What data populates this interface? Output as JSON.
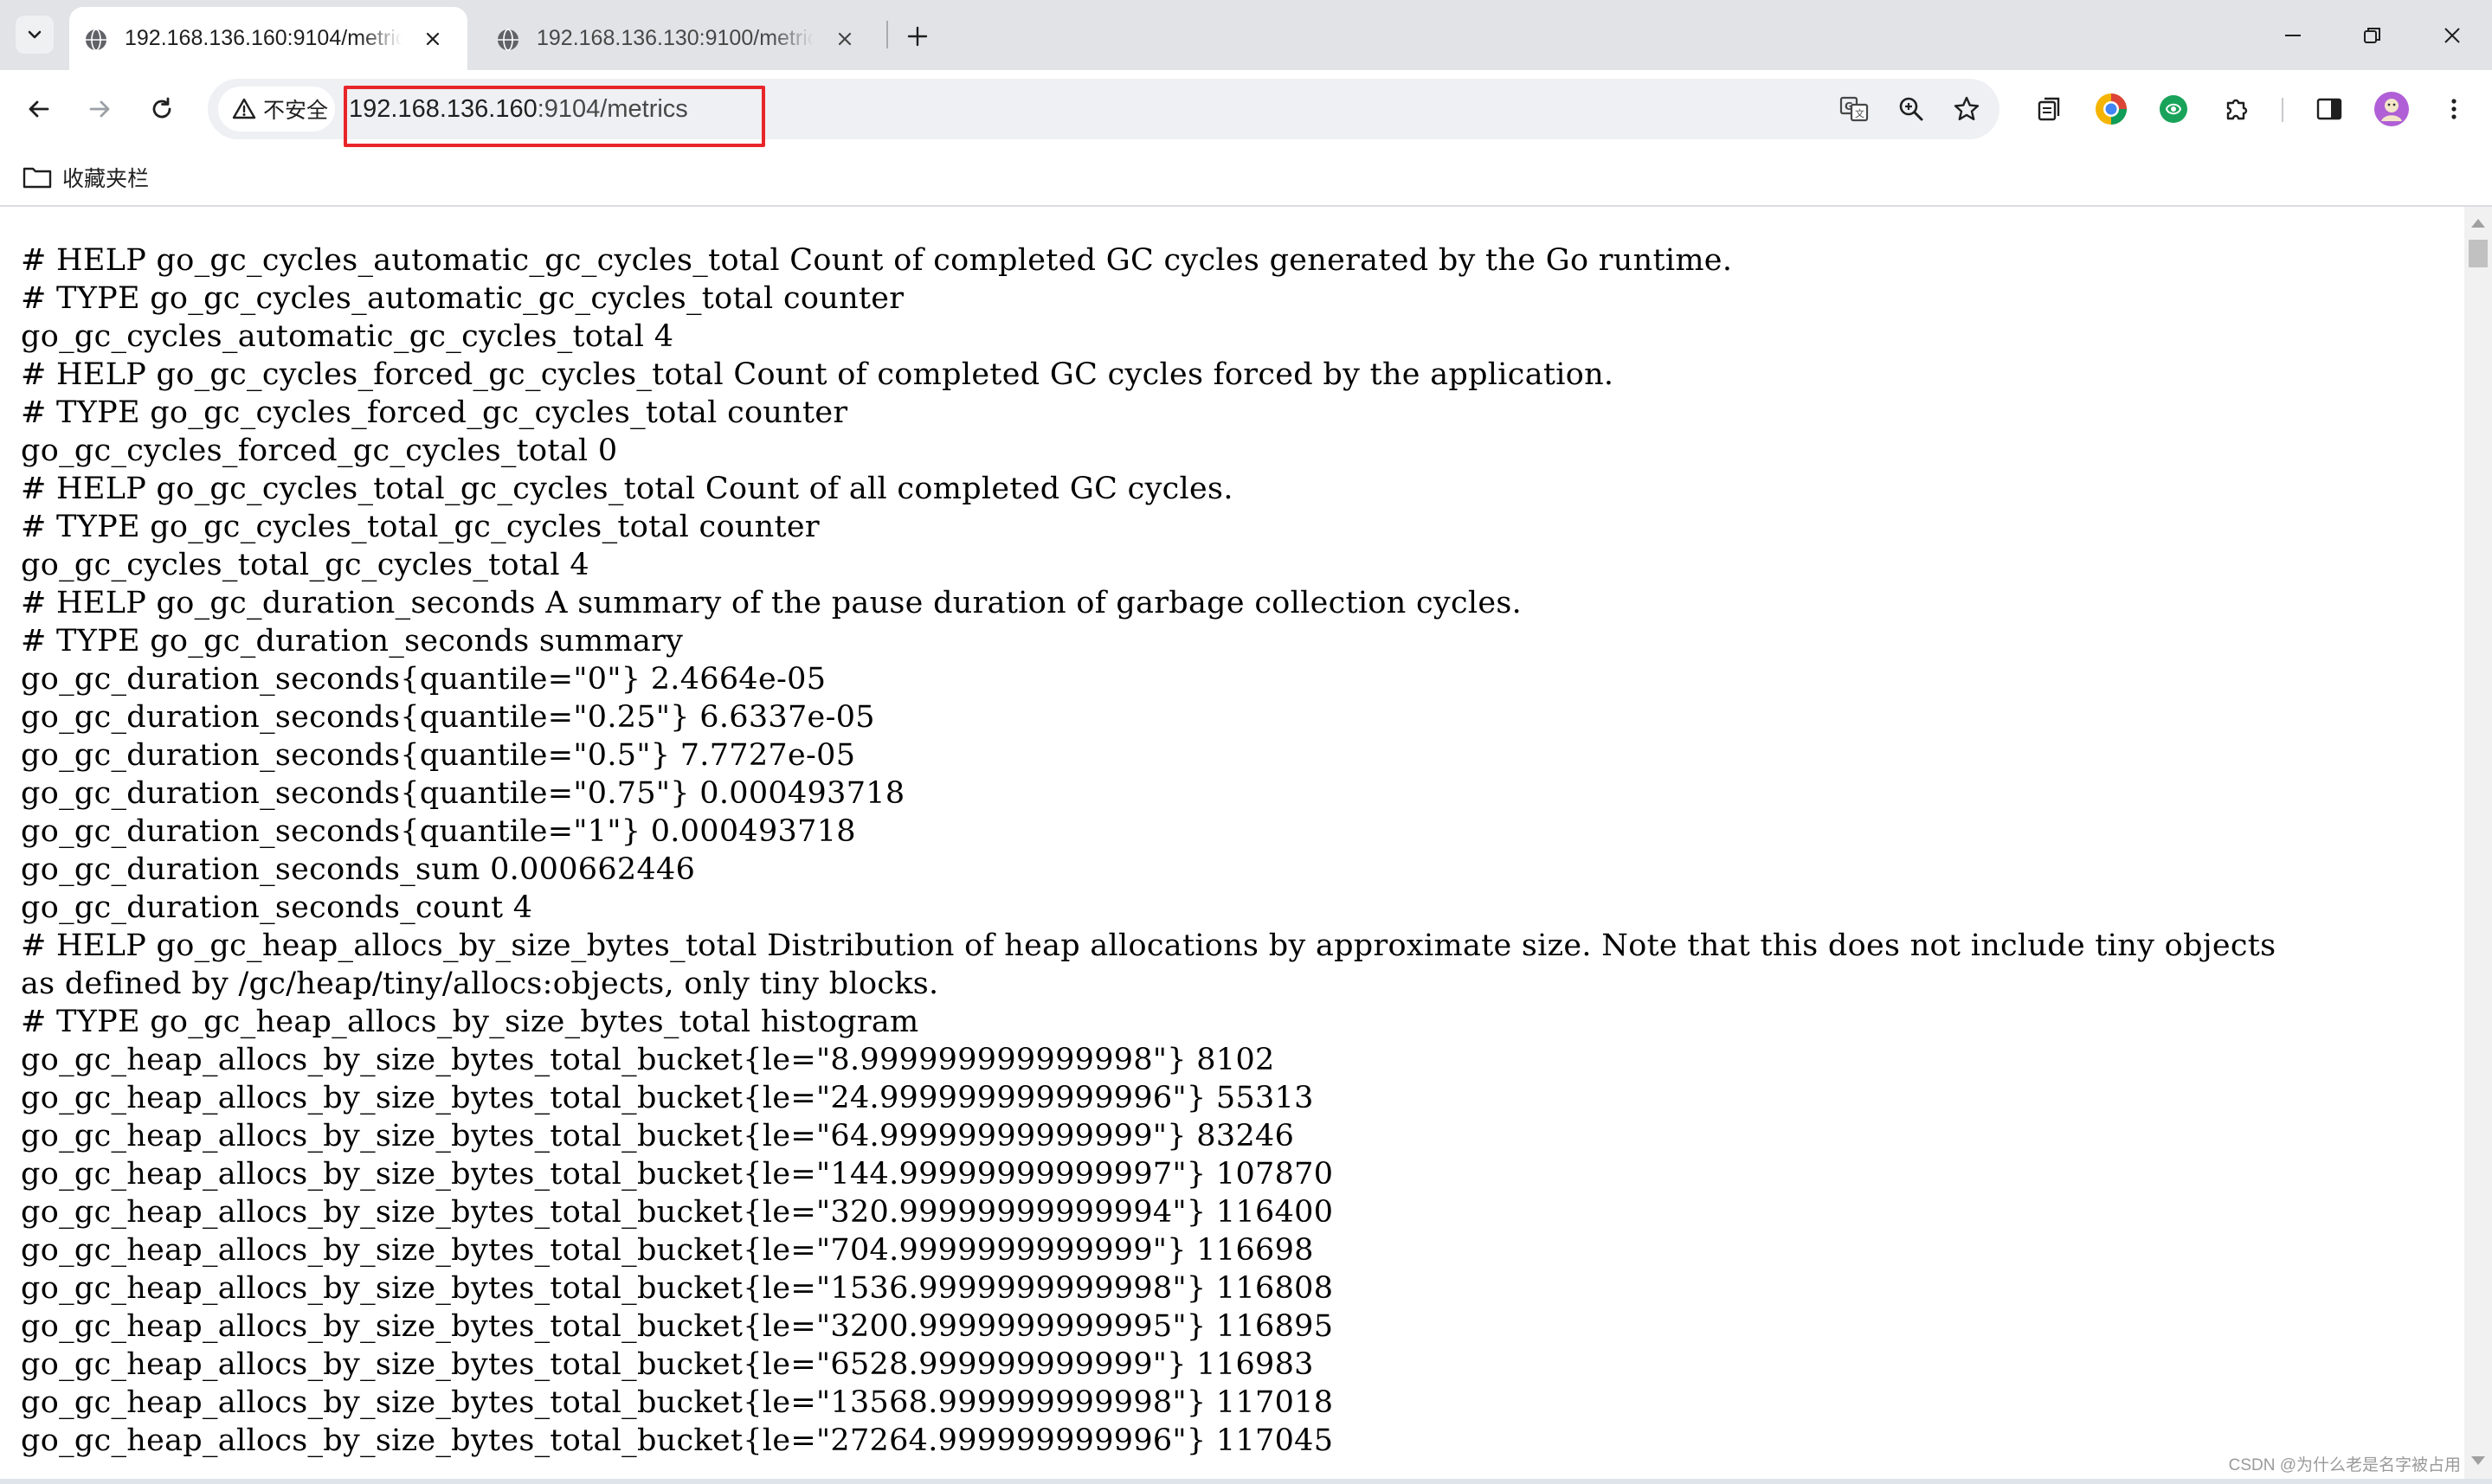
{
  "tabs": [
    {
      "title": "192.168.136.160:9104/metrics",
      "active": true
    },
    {
      "title": "192.168.136.130:9100/metrics",
      "active": false
    }
  ],
  "omnibox": {
    "security_label": "不安全",
    "url_host": "192.168.136.160",
    "url_rest": ":9104/metrics",
    "highlight_color": "#e8262a"
  },
  "bookmarks": {
    "folder_label": "收藏夹栏"
  },
  "metrics_lines": [
    "# HELP go_gc_cycles_automatic_gc_cycles_total Count of completed GC cycles generated by the Go runtime.",
    "# TYPE go_gc_cycles_automatic_gc_cycles_total counter",
    "go_gc_cycles_automatic_gc_cycles_total 4",
    "# HELP go_gc_cycles_forced_gc_cycles_total Count of completed GC cycles forced by the application.",
    "# TYPE go_gc_cycles_forced_gc_cycles_total counter",
    "go_gc_cycles_forced_gc_cycles_total 0",
    "# HELP go_gc_cycles_total_gc_cycles_total Count of all completed GC cycles.",
    "# TYPE go_gc_cycles_total_gc_cycles_total counter",
    "go_gc_cycles_total_gc_cycles_total 4",
    "# HELP go_gc_duration_seconds A summary of the pause duration of garbage collection cycles.",
    "# TYPE go_gc_duration_seconds summary",
    "go_gc_duration_seconds{quantile=\"0\"} 2.4664e-05",
    "go_gc_duration_seconds{quantile=\"0.25\"} 6.6337e-05",
    "go_gc_duration_seconds{quantile=\"0.5\"} 7.7727e-05",
    "go_gc_duration_seconds{quantile=\"0.75\"} 0.000493718",
    "go_gc_duration_seconds{quantile=\"1\"} 0.000493718",
    "go_gc_duration_seconds_sum 0.000662446",
    "go_gc_duration_seconds_count 4",
    "# HELP go_gc_heap_allocs_by_size_bytes_total Distribution of heap allocations by approximate size. Note that this does not include tiny objects",
    "as defined by /gc/heap/tiny/allocs:objects, only tiny blocks.",
    "# TYPE go_gc_heap_allocs_by_size_bytes_total histogram",
    "go_gc_heap_allocs_by_size_bytes_total_bucket{le=\"8.999999999999998\"} 8102",
    "go_gc_heap_allocs_by_size_bytes_total_bucket{le=\"24.999999999999996\"} 55313",
    "go_gc_heap_allocs_by_size_bytes_total_bucket{le=\"64.99999999999999\"} 83246",
    "go_gc_heap_allocs_by_size_bytes_total_bucket{le=\"144.99999999999997\"} 107870",
    "go_gc_heap_allocs_by_size_bytes_total_bucket{le=\"320.99999999999994\"} 116400",
    "go_gc_heap_allocs_by_size_bytes_total_bucket{le=\"704.9999999999999\"} 116698",
    "go_gc_heap_allocs_by_size_bytes_total_bucket{le=\"1536.9999999999998\"} 116808",
    "go_gc_heap_allocs_by_size_bytes_total_bucket{le=\"3200.9999999999995\"} 116895",
    "go_gc_heap_allocs_by_size_bytes_total_bucket{le=\"6528.999999999999\"} 116983",
    "go_gc_heap_allocs_by_size_bytes_total_bucket{le=\"13568.999999999998\"} 117018",
    "go_gc_heap_allocs_by_size_bytes_total_bucket{le=\"27264.999999999996\"} 117045"
  ],
  "watermark": "CSDN @为什么老是名字被占用"
}
